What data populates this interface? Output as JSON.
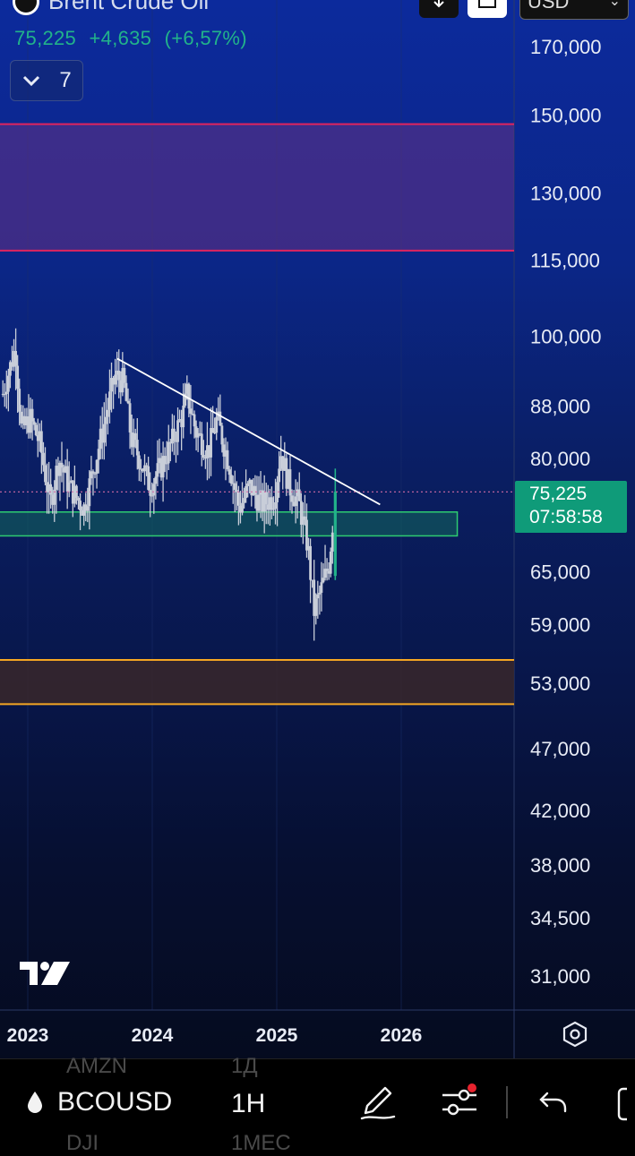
{
  "header": {
    "title": "Brent Crude Oil",
    "last_price": "75,225",
    "change": "+4,635",
    "change_pct": "(+6,57%)",
    "collapse_count": "7",
    "currency": "USD"
  },
  "price_label": {
    "value": "75,225",
    "countdown": "07:58:58",
    "color": "#0f9b79"
  },
  "bottom_bar": {
    "symbol": "BCOUSD",
    "interval": "1H",
    "ghost_symbol_1": "AMZN",
    "ghost_interval_1": "1Д",
    "ghost_symbol_2": "DJI",
    "ghost_interval_2": "1МЕС"
  },
  "colors": {
    "up": "#22b38a",
    "candle": "#c9ced9",
    "resistance_zone": "#e0245e",
    "support_zone": "#f5a623",
    "demand_box": "#2ecc71",
    "trendline": "#ffffff",
    "price_line": "#d16ba5"
  },
  "chart_data": {
    "type": "candlestick",
    "scale": "log",
    "ylim": [
      29000,
      180000
    ],
    "yticks": [
      170000,
      150000,
      130000,
      115000,
      100000,
      88000,
      80000,
      65000,
      59000,
      53000,
      47000,
      42000,
      38000,
      34500,
      31000
    ],
    "ytick_labels": [
      "170,000",
      "150,000",
      "130,000",
      "115,000",
      "100,000",
      "88,000",
      "80,000",
      "65,000",
      "59,000",
      "53,000",
      "47,000",
      "42,000",
      "38,000",
      "34,500",
      "31,000"
    ],
    "xticks": [
      "2023",
      "2024",
      "2025",
      "2026"
    ],
    "xlim": [
      2022.8,
      2026.3
    ],
    "last_price": 75225,
    "zones": [
      {
        "name": "resistance",
        "top": 147500,
        "bottom": 117000,
        "color": "#e0245e"
      },
      {
        "name": "demand",
        "top": 72500,
        "bottom": 69400,
        "x_end": 2026.45,
        "color": "#2ecc71"
      },
      {
        "name": "support",
        "top": 55300,
        "bottom": 51000,
        "color": "#f5a623"
      }
    ],
    "trendline": [
      {
        "x": 2023.72,
        "y": 96000
      },
      {
        "x": 2025.83,
        "y": 73500
      }
    ],
    "price_series": [
      {
        "x": 2022.8,
        "y": 90000
      },
      {
        "x": 2022.9,
        "y": 98000
      },
      {
        "x": 2022.95,
        "y": 84000
      },
      {
        "x": 2023.02,
        "y": 86000
      },
      {
        "x": 2023.1,
        "y": 82000
      },
      {
        "x": 2023.18,
        "y": 73500
      },
      {
        "x": 2023.25,
        "y": 80000
      },
      {
        "x": 2023.33,
        "y": 76000
      },
      {
        "x": 2023.45,
        "y": 73000
      },
      {
        "x": 2023.52,
        "y": 78000
      },
      {
        "x": 2023.6,
        "y": 84000
      },
      {
        "x": 2023.7,
        "y": 93000
      },
      {
        "x": 2023.77,
        "y": 92000
      },
      {
        "x": 2023.83,
        "y": 83000
      },
      {
        "x": 2023.92,
        "y": 79000
      },
      {
        "x": 2023.98,
        "y": 76000
      },
      {
        "x": 2024.05,
        "y": 78000
      },
      {
        "x": 2024.15,
        "y": 82000
      },
      {
        "x": 2024.25,
        "y": 87000
      },
      {
        "x": 2024.28,
        "y": 90000
      },
      {
        "x": 2024.35,
        "y": 84000
      },
      {
        "x": 2024.45,
        "y": 81000
      },
      {
        "x": 2024.52,
        "y": 86000
      },
      {
        "x": 2024.62,
        "y": 79000
      },
      {
        "x": 2024.7,
        "y": 73000
      },
      {
        "x": 2024.78,
        "y": 76000
      },
      {
        "x": 2024.88,
        "y": 73500
      },
      {
        "x": 2024.98,
        "y": 74500
      },
      {
        "x": 2025.03,
        "y": 81000
      },
      {
        "x": 2025.1,
        "y": 76000
      },
      {
        "x": 2025.18,
        "y": 73500
      },
      {
        "x": 2025.25,
        "y": 68000
      },
      {
        "x": 2025.3,
        "y": 60500
      },
      {
        "x": 2025.36,
        "y": 63000
      },
      {
        "x": 2025.42,
        "y": 66000
      },
      {
        "x": 2025.47,
        "y": 75225
      }
    ]
  }
}
